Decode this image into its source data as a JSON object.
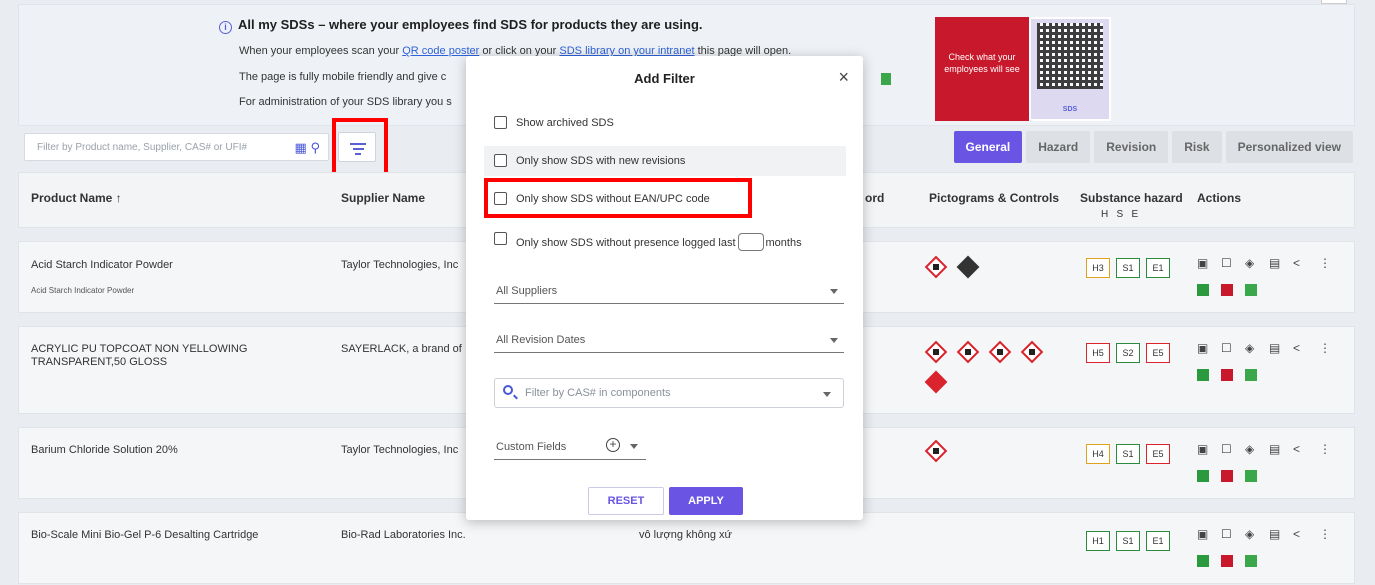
{
  "banner": {
    "title": "All my SDSs – where your employees find SDS for products they are using.",
    "line1_pre": "When your employees scan your ",
    "line1_link1": "QR code poster",
    "line1_mid": " or click on your ",
    "line1_link2": "SDS library on your intranet",
    "line1_post": " this page will open.",
    "line2": "The page is fully mobile friendly and give c",
    "line3": "For administration of your SDS library you s",
    "promo_text": "Check what your employees will see",
    "promo_brand": "SDS"
  },
  "toolbar": {
    "search_placeholder": "Filter by Product name, Supplier, CAS# or UFI#"
  },
  "tabs": [
    "General",
    "Hazard",
    "Revision",
    "Risk",
    "Personalized view"
  ],
  "table": {
    "headers": {
      "product": "Product Name ↑",
      "supplier": "Supplier Name",
      "keyword": "ord",
      "pictograms": "Pictograms & Controls",
      "substance": "Substance hazard",
      "hse": "H   S   E",
      "actions": "Actions"
    },
    "rows": [
      {
        "product": "Acid Starch Indicator Powder",
        "sub": "Acid Starch Indicator Powder",
        "supplier": "Taylor Technologies, Inc",
        "extra": "",
        "h": "H3",
        "s": "S1",
        "e": "E1"
      },
      {
        "product": "ACRYLIC PU TOPCOAT NON YELLOWING TRANSPARENT,50 GLOSS",
        "sub": "",
        "supplier": "SAYERLACK, a brand of",
        "extra": "",
        "h": "H5",
        "s": "S2",
        "e": "E5"
      },
      {
        "product": "Barium Chloride Solution 20%",
        "sub": "",
        "supplier": "Taylor Technologies, Inc",
        "extra": "",
        "h": "H4",
        "s": "S1",
        "e": "E5"
      },
      {
        "product": "Bio-Scale Mini Bio-Gel P-6 Desalting Cartridge",
        "sub": "",
        "supplier": "Bio-Rad Laboratories Inc.",
        "extra": "vô lượng không xứ",
        "h": "H1",
        "s": "S1",
        "e": "E1"
      }
    ]
  },
  "modal": {
    "title": "Add Filter",
    "close": "×",
    "opt_archived": "Show archived SDS",
    "opt_new_revisions": "Only show SDS with new revisions",
    "opt_no_ean": "Only show SDS without EAN/UPC code",
    "opt_presence_pre": "Only show SDS without presence logged last",
    "opt_presence_post": "months",
    "suppliers": "All Suppliers",
    "revision_dates": "All Revision Dates",
    "cas_placeholder": "Filter by CAS# in components",
    "custom_fields": "Custom Fields",
    "reset": "RESET",
    "apply": "APPLY"
  }
}
